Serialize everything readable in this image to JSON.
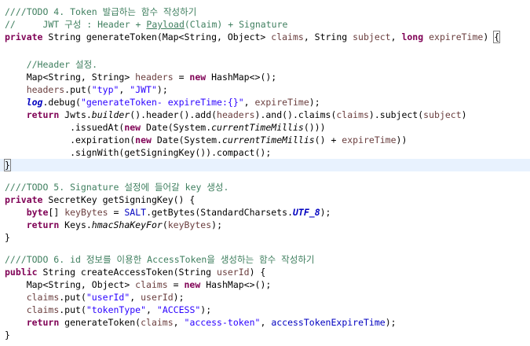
{
  "code": {
    "lines": [
      [
        [
          "cm",
          "////TODO 4. Token 발급하는 함수 작성하기"
        ]
      ],
      [
        [
          "cm",
          "//     JWT 구성 : Header + "
        ],
        [
          "cm-u",
          "Payload"
        ],
        [
          "cm",
          "(Claim) + Signature"
        ]
      ],
      [
        [
          "kw",
          "private"
        ],
        [
          "pl",
          " String generateToken(Map<String, Object> "
        ],
        [
          "var",
          "claims"
        ],
        [
          "pl",
          ", String "
        ],
        [
          "var",
          "subject"
        ],
        [
          "pl",
          ", "
        ],
        [
          "kw",
          "long"
        ],
        [
          "pl",
          " "
        ],
        [
          "var",
          "expireTime"
        ],
        [
          "pl",
          ") "
        ],
        [
          "br-hl",
          "{"
        ]
      ],
      [],
      [
        [
          "pl",
          "    "
        ],
        [
          "cm",
          "//Header 설정."
        ]
      ],
      [
        [
          "pl",
          "    Map<String, String> "
        ],
        [
          "var",
          "headers"
        ],
        [
          "pl",
          " = "
        ],
        [
          "kw",
          "new"
        ],
        [
          "pl",
          " HashMap<>();"
        ]
      ],
      [
        [
          "pl",
          "    "
        ],
        [
          "var",
          "headers"
        ],
        [
          "pl",
          ".put("
        ],
        [
          "str",
          "\"typ\""
        ],
        [
          "pl",
          ", "
        ],
        [
          "str",
          "\"JWT\""
        ],
        [
          "pl",
          ");"
        ]
      ],
      [
        [
          "pl",
          "    "
        ],
        [
          "fld-bi",
          "log"
        ],
        [
          "pl",
          ".debug("
        ],
        [
          "str",
          "\"generateToken- expireTime:{}\""
        ],
        [
          "pl",
          ", "
        ],
        [
          "var",
          "expireTime"
        ],
        [
          "pl",
          ");"
        ]
      ],
      [
        [
          "pl",
          "    "
        ],
        [
          "kw",
          "return"
        ],
        [
          "pl",
          " Jwts."
        ],
        [
          "st-i",
          "builder"
        ],
        [
          "pl",
          "().header().add("
        ],
        [
          "var",
          "headers"
        ],
        [
          "pl",
          ").and().claims("
        ],
        [
          "var",
          "claims"
        ],
        [
          "pl",
          ").subject("
        ],
        [
          "var",
          "subject"
        ],
        [
          "pl",
          ")"
        ]
      ],
      [
        [
          "pl",
          "            .issuedAt("
        ],
        [
          "kw",
          "new"
        ],
        [
          "pl",
          " Date(System."
        ],
        [
          "st-i",
          "currentTimeMillis"
        ],
        [
          "pl",
          "()))"
        ]
      ],
      [
        [
          "pl",
          "            .expiration("
        ],
        [
          "kw",
          "new"
        ],
        [
          "pl",
          " Date(System."
        ],
        [
          "st-i",
          "currentTimeMillis"
        ],
        [
          "pl",
          "() + "
        ],
        [
          "var",
          "expireTime"
        ],
        [
          "pl",
          "))"
        ]
      ],
      [
        [
          "pl",
          "            .signWith(getSigningKey()).compact();"
        ]
      ],
      [
        [
          "br-hl",
          "}"
        ],
        [
          "caret",
          ""
        ]
      ],
      [],
      [
        [
          "cm",
          "////TODO 5. Signature 설정에 들어갈 key 생성."
        ]
      ],
      [
        [
          "kw",
          "private"
        ],
        [
          "pl",
          " SecretKey getSigningKey() {"
        ]
      ],
      [
        [
          "pl",
          "    "
        ],
        [
          "kw",
          "byte"
        ],
        [
          "pl",
          "[] "
        ],
        [
          "var",
          "keyBytes"
        ],
        [
          "pl",
          " = "
        ],
        [
          "fld",
          "SALT"
        ],
        [
          "pl",
          ".getBytes(StandardCharsets."
        ],
        [
          "fld-bi",
          "UTF_8"
        ],
        [
          "pl",
          ");"
        ]
      ],
      [
        [
          "pl",
          "    "
        ],
        [
          "kw",
          "return"
        ],
        [
          "pl",
          " Keys."
        ],
        [
          "st-i",
          "hmacShaKeyFor"
        ],
        [
          "pl",
          "("
        ],
        [
          "var",
          "keyBytes"
        ],
        [
          "pl",
          ");"
        ]
      ],
      [
        [
          "pl",
          "}"
        ]
      ],
      [],
      [
        [
          "cm",
          "////TODO 6. id 정보를 이용한 AccessToken을 생성하는 함수 작성하기"
        ]
      ],
      [
        [
          "kw",
          "public"
        ],
        [
          "pl",
          " String createAccessToken(String "
        ],
        [
          "var",
          "userId"
        ],
        [
          "pl",
          ") {"
        ]
      ],
      [
        [
          "pl",
          "    Map<String, Object> "
        ],
        [
          "var",
          "claims"
        ],
        [
          "pl",
          " = "
        ],
        [
          "kw",
          "new"
        ],
        [
          "pl",
          " HashMap<>();"
        ]
      ],
      [
        [
          "pl",
          "    "
        ],
        [
          "var",
          "claims"
        ],
        [
          "pl",
          ".put("
        ],
        [
          "str",
          "\"userId\""
        ],
        [
          "pl",
          ", "
        ],
        [
          "var",
          "userId"
        ],
        [
          "pl",
          ");"
        ]
      ],
      [
        [
          "pl",
          "    "
        ],
        [
          "var",
          "claims"
        ],
        [
          "pl",
          ".put("
        ],
        [
          "str",
          "\"tokenType\""
        ],
        [
          "pl",
          ", "
        ],
        [
          "str",
          "\"ACCESS\""
        ],
        [
          "pl",
          ");"
        ]
      ],
      [
        [
          "pl",
          "    "
        ],
        [
          "kw",
          "return"
        ],
        [
          "pl",
          " generateToken("
        ],
        [
          "var",
          "claims"
        ],
        [
          "pl",
          ", "
        ],
        [
          "str",
          "\"access-token\""
        ],
        [
          "pl",
          ", "
        ],
        [
          "fld",
          "accessTokenExpireTime"
        ],
        [
          "pl",
          ");"
        ]
      ],
      [
        [
          "pl",
          "}"
        ]
      ]
    ]
  },
  "colors": {
    "comment": "#3f7f5f",
    "keyword": "#7f0055",
    "string": "#2a00ff",
    "field": "#0000c0",
    "local_variable": "#6a3e3e",
    "current_line_highlight": "#e8f2fe"
  }
}
